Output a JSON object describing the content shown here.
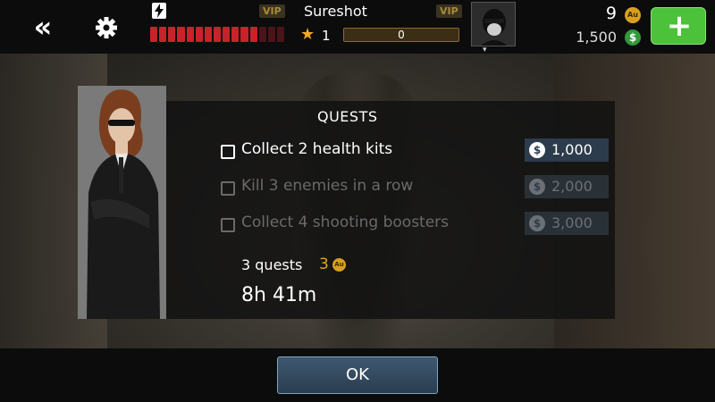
{
  "topbar": {
    "player_name": "Sureshot",
    "vip_label": "VIP",
    "rank": "1",
    "xp_value": "0",
    "health": {
      "filled": 12,
      "total": 15
    },
    "gold_amount": "9",
    "gold_symbol": "Au",
    "cash_amount": "1,500",
    "cash_symbol": "$",
    "add_label": "+"
  },
  "quests": {
    "title": "QUESTS",
    "items": [
      {
        "label": "Collect 2 health kits",
        "reward": "1,000",
        "completed": false
      },
      {
        "label": "Kill 3 enemies in a row",
        "reward": "2,000",
        "completed": true
      },
      {
        "label": "Collect 4 shooting boosters",
        "reward": "3,000",
        "completed": true
      }
    ],
    "reward_symbol": "$",
    "summary_label": "3 quests",
    "summary_gold": "3",
    "summary_gold_symbol": "Au",
    "timer": "8h 41m"
  },
  "dialog": {
    "ok_label": "OK"
  },
  "colors": {
    "health_red": "#c8222a",
    "gold": "#d9a020",
    "cash_green": "#2f9a3a",
    "add_green": "#4cc13a",
    "ok_blue": "#3f5870"
  },
  "icons": [
    "back-chevrons-icon",
    "gear-icon",
    "bolt-icon",
    "star-icon",
    "avatar-icon",
    "gold-coin-icon",
    "cash-coin-icon",
    "plus-icon",
    "checkbox-icon"
  ]
}
